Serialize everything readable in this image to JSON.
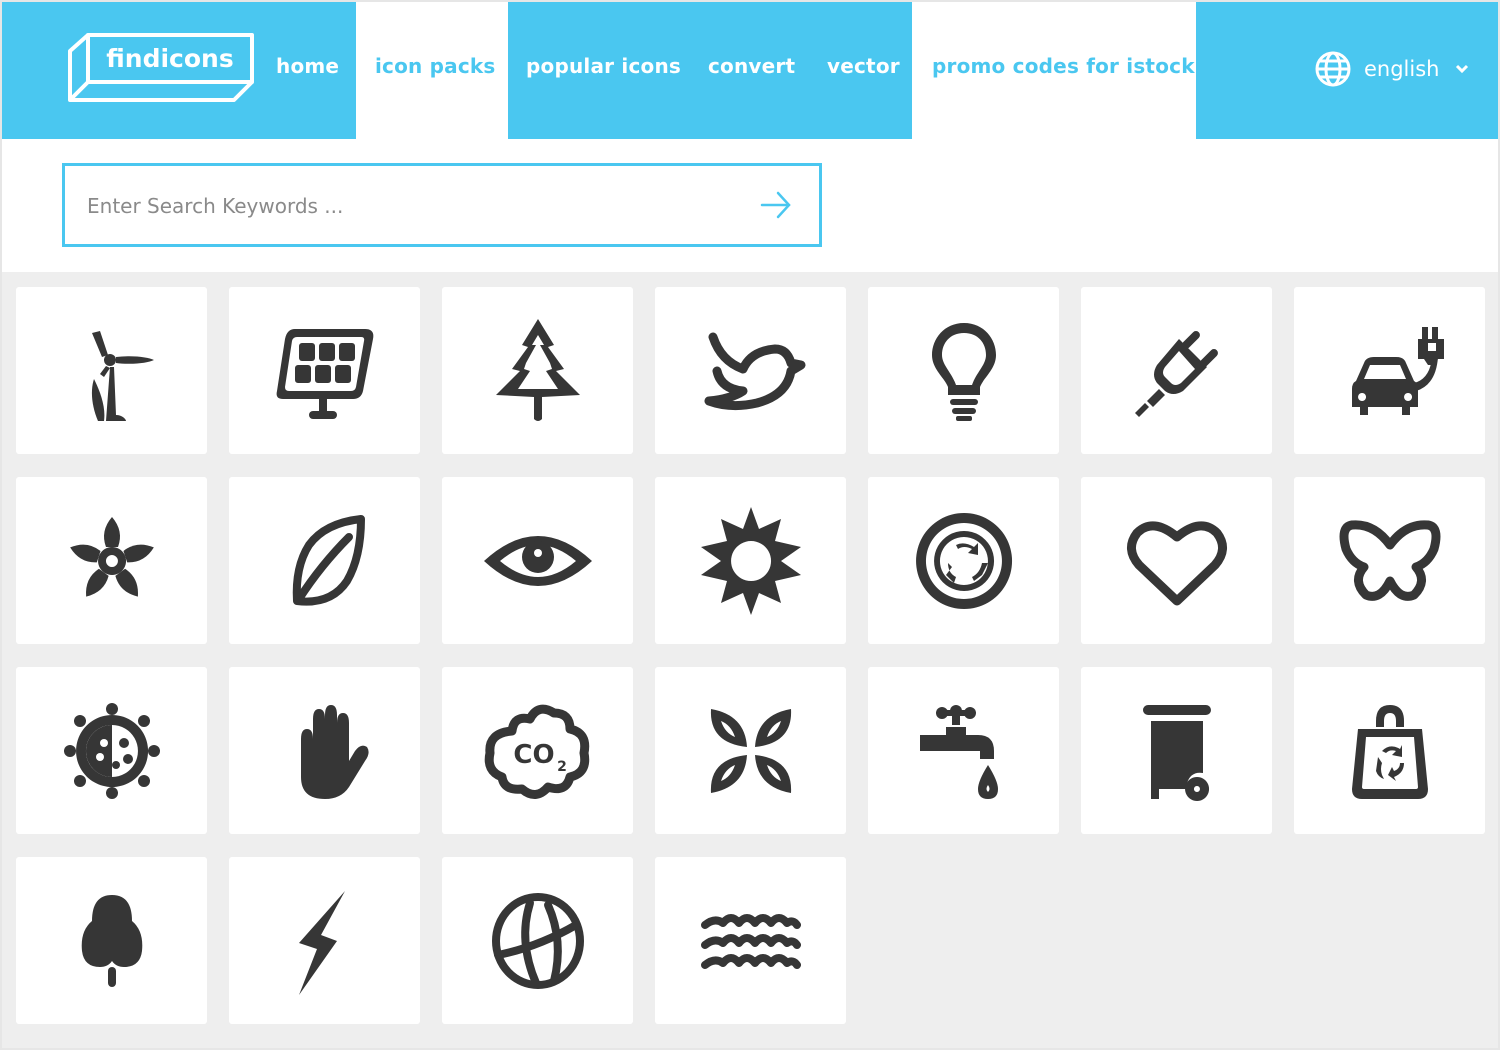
{
  "brand": {
    "name": "findicons"
  },
  "nav": {
    "items": [
      {
        "label": "home",
        "active": false
      },
      {
        "label": "icon packs",
        "active": true
      },
      {
        "label": "popular icons",
        "active": false
      },
      {
        "label": "convert",
        "active": false
      },
      {
        "label": "vector",
        "active": false
      },
      {
        "label": "promo codes for istock",
        "active": true
      }
    ],
    "language": {
      "label": "english",
      "icon": "globe-icon"
    }
  },
  "search": {
    "placeholder": "Enter Search Keywords ...",
    "value": "",
    "submit_icon": "arrow-right-icon"
  },
  "colors": {
    "accent": "#4ac7f0",
    "icon": "#363636",
    "background": "#eeeeee",
    "tile": "#ffffff"
  },
  "icons": [
    {
      "name": "wind-turbine"
    },
    {
      "name": "solar-panel"
    },
    {
      "name": "pine-tree"
    },
    {
      "name": "bird"
    },
    {
      "name": "light-bulb"
    },
    {
      "name": "power-plug"
    },
    {
      "name": "electric-car"
    },
    {
      "name": "flower"
    },
    {
      "name": "leaf"
    },
    {
      "name": "eye"
    },
    {
      "name": "sun"
    },
    {
      "name": "recycle-circle"
    },
    {
      "name": "heart"
    },
    {
      "name": "butterfly"
    },
    {
      "name": "ladybug"
    },
    {
      "name": "hand"
    },
    {
      "name": "co2-cloud"
    },
    {
      "name": "four-leaves"
    },
    {
      "name": "water-tap"
    },
    {
      "name": "wheelie-bin"
    },
    {
      "name": "recycle-bag"
    },
    {
      "name": "tree"
    },
    {
      "name": "lightning"
    },
    {
      "name": "globe"
    },
    {
      "name": "waves"
    }
  ]
}
